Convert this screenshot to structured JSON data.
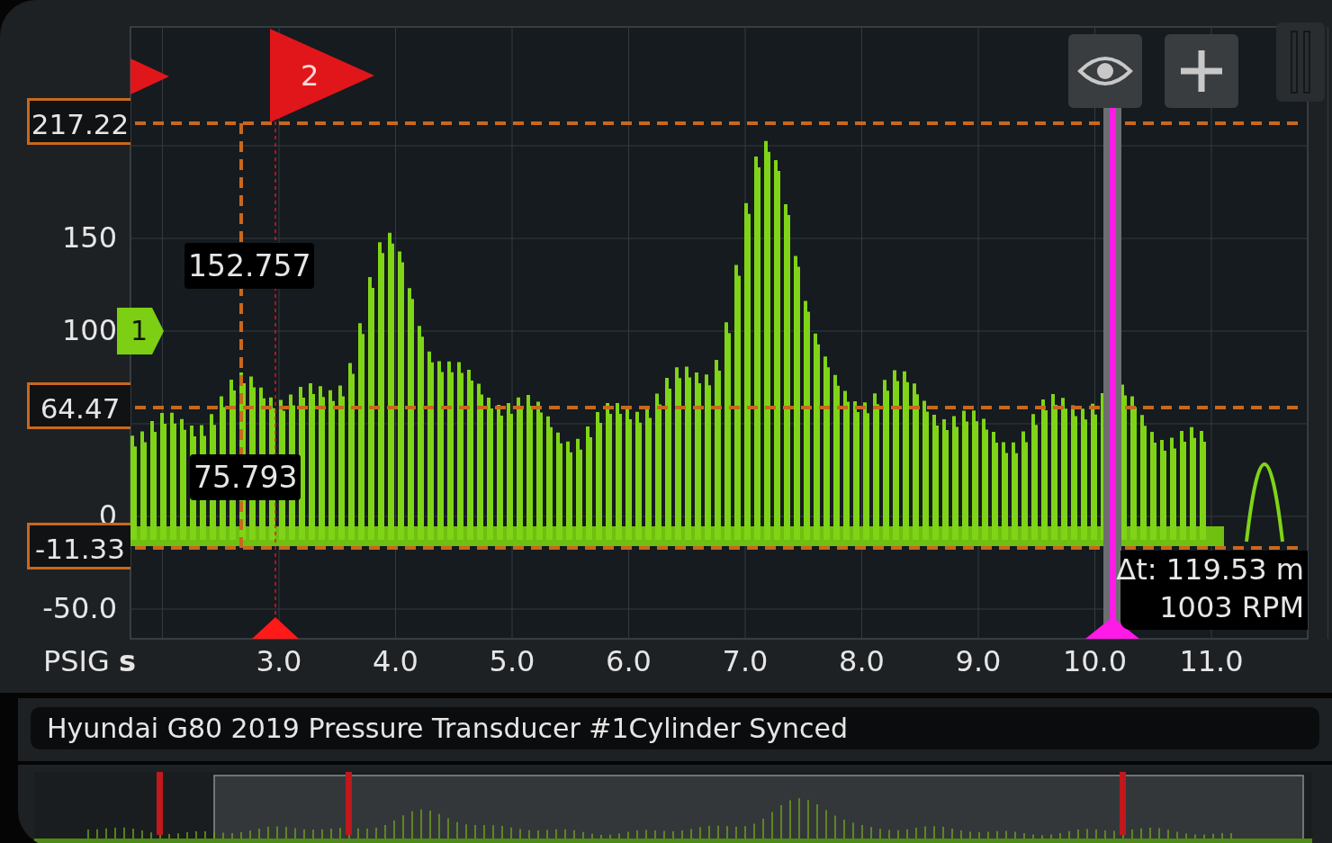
{
  "y_axis": {
    "ticks": [
      "150",
      "100",
      "0",
      "-50.0"
    ]
  },
  "x_axis": {
    "unit_label": "PSIG **s**",
    "ticks": [
      "3.0",
      "4.0",
      "5.0",
      "6.0",
      "7.0",
      "8.0",
      "9.0",
      "10.0",
      "11.0"
    ]
  },
  "level_cursors": [
    {
      "value": "217.22"
    },
    {
      "value": "64.47"
    },
    {
      "value": "-11.33"
    }
  ],
  "markers": [
    {
      "label": "1",
      "color": "#7ccf12"
    },
    {
      "label": "2",
      "color": "#e0161b"
    }
  ],
  "readouts": [
    "152.757",
    "75.793"
  ],
  "cursor_readout": {
    "delta": "Δt: 119.53 m",
    "rpm": "1003 RPM"
  },
  "title": "Hyundai G80 2019 Pressure Transducer #1Cylinder Synced"
}
